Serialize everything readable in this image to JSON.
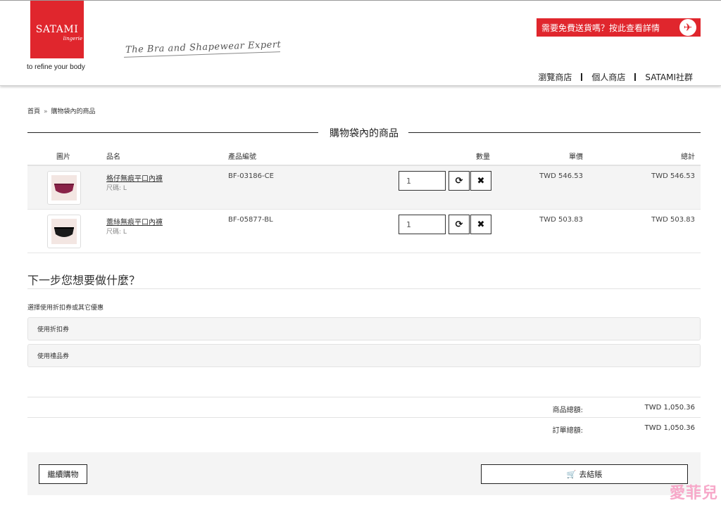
{
  "header": {
    "brand": "SATAMI",
    "brand_sub": "lingerie",
    "tagline": "to refine your body",
    "script_tagline": "The Bra and Shapewear Expert",
    "promo_text": "需要免費送貨嗎？按此查看詳情",
    "nav": [
      "瀏覽商店",
      "個人商店",
      "SATAMI社群"
    ]
  },
  "breadcrumb": {
    "home": "首頁",
    "divider": "»",
    "current": "購物袋內的商品"
  },
  "cart": {
    "title": "購物袋內的商品",
    "columns": [
      "圖片",
      "品名",
      "產品編號",
      "數量",
      "單價",
      "總計"
    ],
    "items": [
      {
        "name": "格仔無痕平口內褲",
        "size": "尺碼: L",
        "code": "BF-03186-CE",
        "qty": "1",
        "unit_price": "TWD 546.53",
        "total": "TWD 546.53",
        "color": "#8a2247"
      },
      {
        "name": "蕾絲無痕平口內褲",
        "size": "尺碼: L",
        "code": "BF-05877-BL",
        "qty": "1",
        "unit_price": "TWD 503.83",
        "total": "TWD 503.83",
        "color": "#1a1a1a"
      }
    ]
  },
  "next_step": {
    "title": "下一步您想要做什麼？",
    "subtitle": "選擇使用折扣券或其它優惠",
    "options": [
      "使用折扣券",
      "使用禮品券"
    ]
  },
  "totals": [
    {
      "label": "商品總額:",
      "amount": "TWD 1,050.36"
    },
    {
      "label": "訂單總額:",
      "amount": "TWD 1,050.36"
    }
  ],
  "actions": {
    "continue": "繼續購物",
    "checkout": "去結賬"
  },
  "watermark": "愛菲兒",
  "colors": {
    "brand_red": "#e0262d",
    "watermark_pink": "#f7a8c9"
  }
}
